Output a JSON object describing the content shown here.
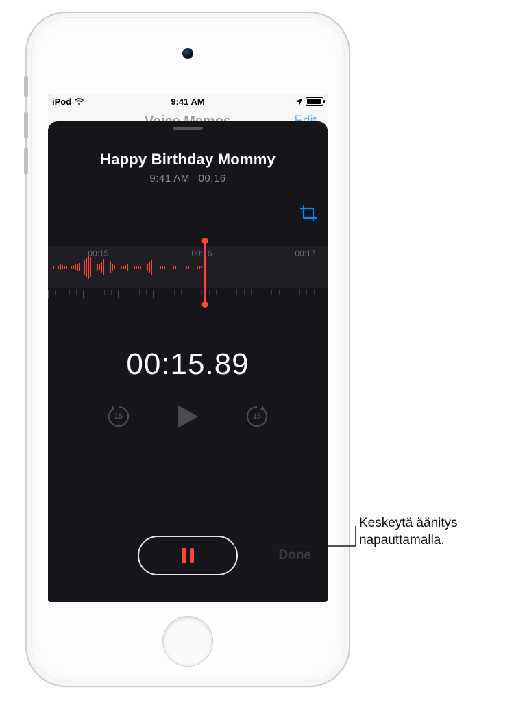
{
  "status": {
    "device": "iPod",
    "time": "9:41 AM"
  },
  "header": {
    "app_title": "Voice Memos",
    "edit": "Edit"
  },
  "recording": {
    "title": "Happy Birthday Mommy",
    "sub_time": "9:41 AM",
    "sub_duration": "00:16",
    "elapsed": "00:15.89",
    "ticks": [
      "00:15",
      "00:16",
      "00:17"
    ],
    "skip_seconds": "15",
    "done": "Done"
  },
  "callout": {
    "text": "Keskeytä äänitys napauttamalla."
  },
  "colors": {
    "accent_red": "#ff453a",
    "accent_blue": "#0a84ff"
  }
}
